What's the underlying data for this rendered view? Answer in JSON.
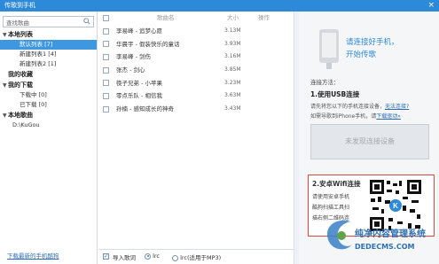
{
  "title": "传歌到手机",
  "close_glyph": "×",
  "search": {
    "placeholder": "查找歌曲"
  },
  "sidebar": {
    "sections": [
      {
        "label": "本地列表",
        "items": [
          "默认列表 [7]",
          "新建列表1 [4]",
          "新建列表2 [1]"
        ],
        "selected": 0
      },
      {
        "label": "我的收藏",
        "items": []
      },
      {
        "label": "我的下载",
        "items": [
          "下载中 [0]",
          "已下载 [0]"
        ]
      },
      {
        "label": "本地歌曲",
        "items": [
          "D:\\KuGou"
        ]
      }
    ],
    "footer_link": "下载最新的手机酷狗"
  },
  "list": {
    "headers": {
      "name": "歌曲名",
      "size": "大小",
      "action": "操作"
    },
    "rows": [
      {
        "name": "李易峰 - 追梦心愿",
        "size": "3.13M"
      },
      {
        "name": "华晨宇 - 假装快乐的童话",
        "size": "3.93M"
      },
      {
        "name": "李易峰 - 剑伤",
        "size": "3.16M"
      },
      {
        "name": "张杰 - 剑心",
        "size": "3.85M"
      },
      {
        "name": "筷子兄弟 - 小苹果",
        "size": "3.23M"
      },
      {
        "name": "零点乐队 - 相信我",
        "size": "3.63M"
      },
      {
        "name": "孙楠 - 感知成长的神奇",
        "size": "3.43M"
      }
    ],
    "footer": {
      "import_lyrics": "导入歌词",
      "lrc": "lrc",
      "lrc_mp3": "lrc(适用于MP3)"
    }
  },
  "right": {
    "prompt_line1": "请连接好手机，",
    "prompt_line2": "开始传歌",
    "method_label": "连接方法：",
    "usb_title": "1.使用USB连接",
    "usb_line1": "请先将您以下的手机连接设备，",
    "usb_link": "无法连接?",
    "usb_line2": "如需导歌到iPhone手机，请",
    "usb_link2": "下载驱动»",
    "device_button": "未发现连接设备",
    "wifi_title": "2.安卓Wifi连接",
    "wifi_lines": [
      "请使用安卓手机",
      "酷狗扫描工具扫",
      "描右侧二维码连"
    ]
  },
  "watermark": {
    "line1": "纯净内容管理系统",
    "line2": "DEDECMS.COM"
  },
  "colors": {
    "accent": "#2d8ad8",
    "selection": "#3f97e0",
    "wifi_border": "#d94a3a"
  }
}
